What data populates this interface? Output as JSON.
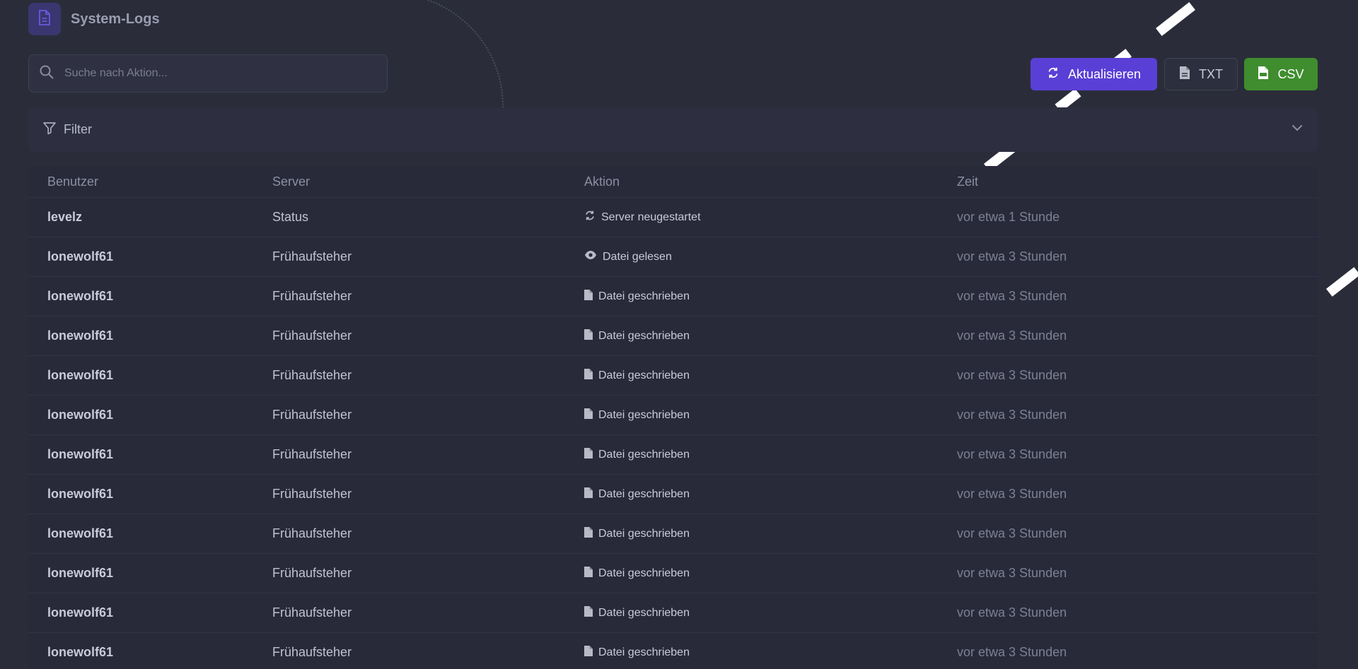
{
  "page": {
    "title": "System-Logs"
  },
  "search": {
    "placeholder": "Suche nach Aktion..."
  },
  "toolbar": {
    "refresh_label": "Aktualisieren",
    "txt_label": "TXT",
    "csv_label": "CSV"
  },
  "filter": {
    "label": "Filter"
  },
  "table": {
    "headers": [
      "Benutzer",
      "Server",
      "Aktion",
      "Zeit"
    ],
    "rows": [
      {
        "user": "levelz",
        "server": "Status",
        "action": "Server neugestartet",
        "action_icon": "refresh-icon",
        "time": "vor etwa 1 Stunde"
      },
      {
        "user": "lonewolf61",
        "server": "Frühaufsteher",
        "action": "Datei gelesen",
        "action_icon": "eye-icon",
        "time": "vor etwa 3 Stunden"
      },
      {
        "user": "lonewolf61",
        "server": "Frühaufsteher",
        "action": "Datei geschrieben",
        "action_icon": "file-icon",
        "time": "vor etwa 3 Stunden"
      },
      {
        "user": "lonewolf61",
        "server": "Frühaufsteher",
        "action": "Datei geschrieben",
        "action_icon": "file-icon",
        "time": "vor etwa 3 Stunden"
      },
      {
        "user": "lonewolf61",
        "server": "Frühaufsteher",
        "action": "Datei geschrieben",
        "action_icon": "file-icon",
        "time": "vor etwa 3 Stunden"
      },
      {
        "user": "lonewolf61",
        "server": "Frühaufsteher",
        "action": "Datei geschrieben",
        "action_icon": "file-icon",
        "time": "vor etwa 3 Stunden"
      },
      {
        "user": "lonewolf61",
        "server": "Frühaufsteher",
        "action": "Datei geschrieben",
        "action_icon": "file-icon",
        "time": "vor etwa 3 Stunden"
      },
      {
        "user": "lonewolf61",
        "server": "Frühaufsteher",
        "action": "Datei geschrieben",
        "action_icon": "file-icon",
        "time": "vor etwa 3 Stunden"
      },
      {
        "user": "lonewolf61",
        "server": "Frühaufsteher",
        "action": "Datei geschrieben",
        "action_icon": "file-icon",
        "time": "vor etwa 3 Stunden"
      },
      {
        "user": "lonewolf61",
        "server": "Frühaufsteher",
        "action": "Datei geschrieben",
        "action_icon": "file-icon",
        "time": "vor etwa 3 Stunden"
      },
      {
        "user": "lonewolf61",
        "server": "Frühaufsteher",
        "action": "Datei geschrieben",
        "action_icon": "file-icon",
        "time": "vor etwa 3 Stunden"
      },
      {
        "user": "lonewolf61",
        "server": "Frühaufsteher",
        "action": "Datei geschrieben",
        "action_icon": "file-icon",
        "time": "vor etwa 3 Stunden"
      }
    ]
  },
  "colors": {
    "background": "#2a2d39",
    "accent": "#5a3fd6",
    "csv_green": "#3f8d2e",
    "card": "#282a3a"
  }
}
